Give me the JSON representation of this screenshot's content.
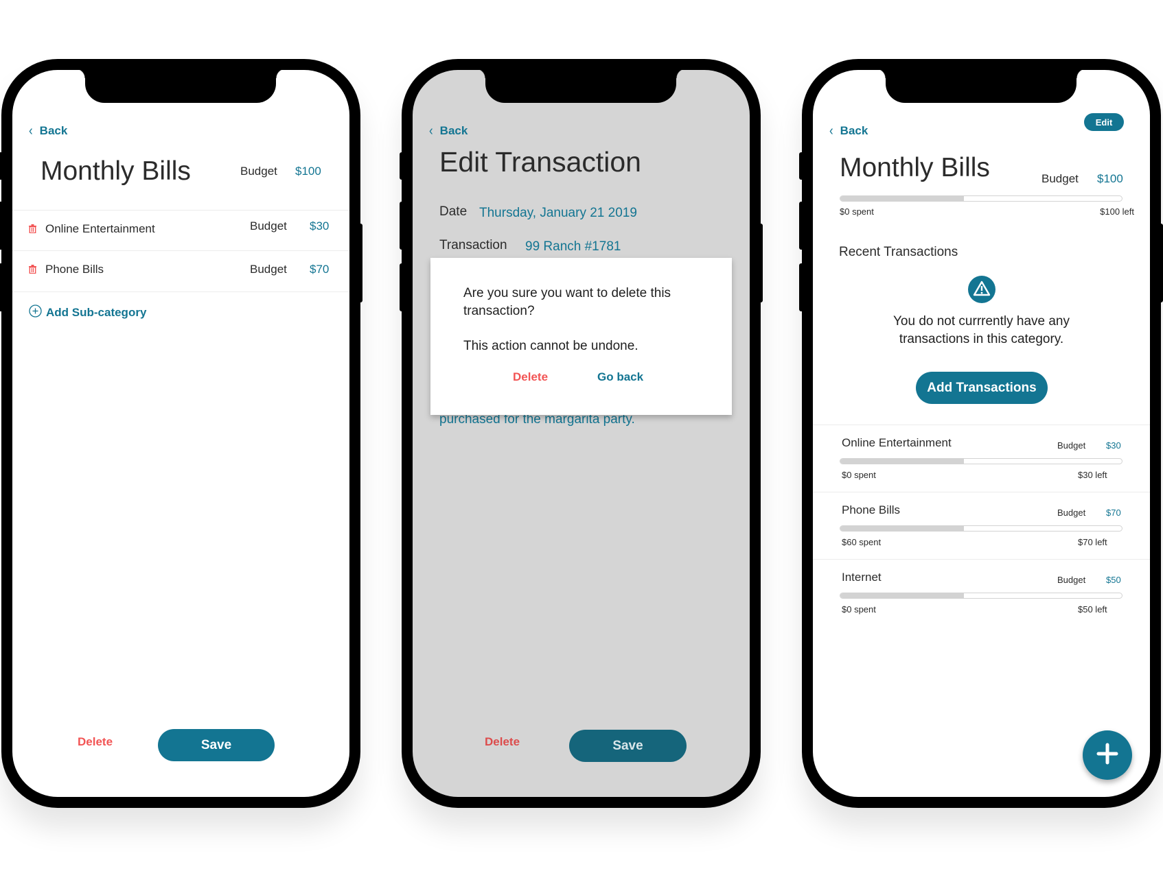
{
  "colors": {
    "accent": "#137592",
    "danger": "#f25454",
    "overlay_bg": "#d5d5d5",
    "bar_track": "#d3d3d3"
  },
  "phone1": {
    "back_label": "Back",
    "title": "Monthly Bills",
    "budget_label": "Budget",
    "budget_value": "$100",
    "subcategories": [
      {
        "name": "Online Entertainment",
        "budget_label": "Budget",
        "budget_value": "$30",
        "icon": "trash-icon"
      },
      {
        "name": "Phone Bills",
        "budget_label": "Budget",
        "budget_value": "$70",
        "icon": "trash-icon"
      }
    ],
    "add_subcategory_label": "Add Sub-category",
    "delete_label": "Delete",
    "save_label": "Save"
  },
  "phone2": {
    "back_label": "Back",
    "title": "Edit Transaction",
    "date_label": "Date",
    "date_value": "Thursday, January 21 2019",
    "transaction_label": "Transaction",
    "transaction_value": "99 Ranch #1781",
    "note_partial": "purchased for the margarita party.",
    "modal": {
      "question": "Are you sure you want to delete this transaction?",
      "warning": "This action cannot be undone.",
      "delete_label": "Delete",
      "go_back_label": "Go back"
    },
    "delete_label": "Delete",
    "save_label": "Save"
  },
  "phone3": {
    "back_label": "Back",
    "edit_label": "Edit",
    "title": "Monthly Bills",
    "budget_label": "Budget",
    "budget_value": "$100",
    "progress": {
      "spent_label": "$0 spent",
      "left_label": "$100 left",
      "fill_fraction": 0.44
    },
    "recent_heading": "Recent Transactions",
    "empty_icon": "warning-icon",
    "empty_message_line1": "You do not currrently have any",
    "empty_message_line2": "transactions in this category.",
    "add_transactions_label": "Add Transactions",
    "subcategories": [
      {
        "name": "Online Entertainment",
        "budget_label": "Budget",
        "budget_value": "$30",
        "spent_label": "$0 spent",
        "left_label": "$30 left",
        "fill_fraction": 0.44
      },
      {
        "name": "Phone Bills",
        "budget_label": "Budget",
        "budget_value": "$70",
        "spent_label": "$60 spent",
        "left_label": "$70 left",
        "fill_fraction": 0.44
      },
      {
        "name": "Internet",
        "budget_label": "Budget",
        "budget_value": "$50",
        "spent_label": "$0 spent",
        "left_label": "$50 left",
        "fill_fraction": 0.44
      }
    ],
    "fab_icon": "plus-icon"
  }
}
